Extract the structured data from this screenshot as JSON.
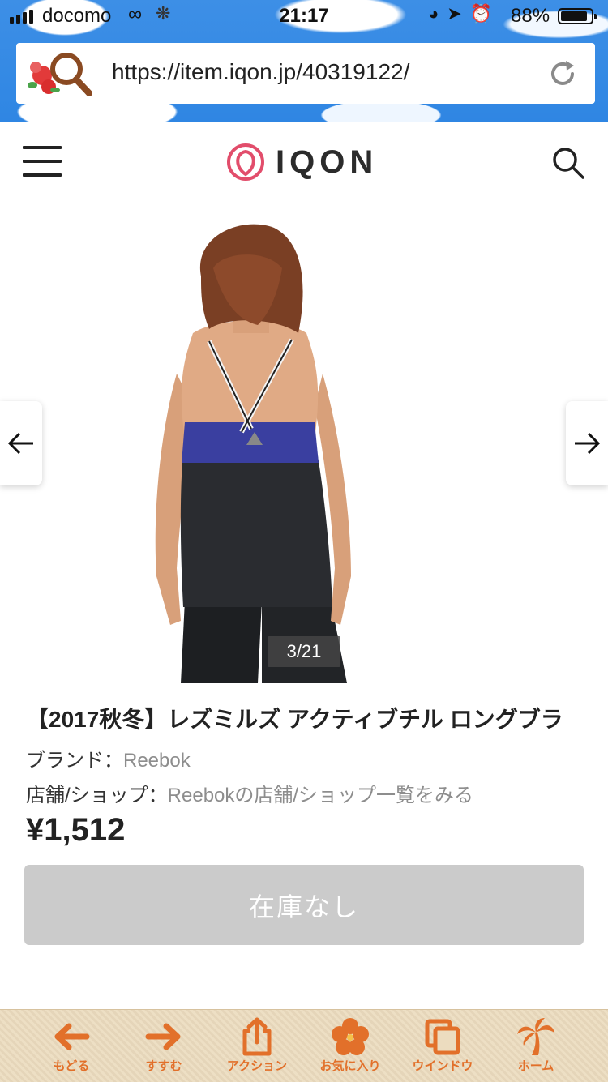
{
  "status_bar": {
    "carrier": "docomo",
    "time": "21:17",
    "battery_percent": "88%",
    "battery_level": 0.88
  },
  "browser": {
    "url": "https://item.iqon.jp/40319122/"
  },
  "site": {
    "brand": "IQON"
  },
  "gallery": {
    "counter": "3/21"
  },
  "product": {
    "title": "【2017秋冬】レズミルズ アクティブチル ロングブラ",
    "brand_label": "ブランド：",
    "brand_value": "Reebok",
    "shop_label": "店舗/ショップ：",
    "shop_value": "Reebokの店舗/ショップ一覧をみる",
    "price": "¥1,512",
    "stock_button": "在庫なし"
  },
  "toolbar": {
    "items": [
      {
        "label": "もどる",
        "icon": "back-arrow-icon"
      },
      {
        "label": "すすむ",
        "icon": "forward-arrow-icon"
      },
      {
        "label": "アクション",
        "icon": "share-icon"
      },
      {
        "label": "お気に入り",
        "icon": "hibiscus-icon"
      },
      {
        "label": "ウインドウ",
        "icon": "windows-icon"
      },
      {
        "label": "ホーム",
        "icon": "palm-tree-icon"
      }
    ],
    "accent_color": "#e2702a"
  },
  "colors": {
    "sky_blue": "#2f86e3",
    "disabled_button": "#cbcbcb",
    "brand_pink": "#e24d6b"
  }
}
